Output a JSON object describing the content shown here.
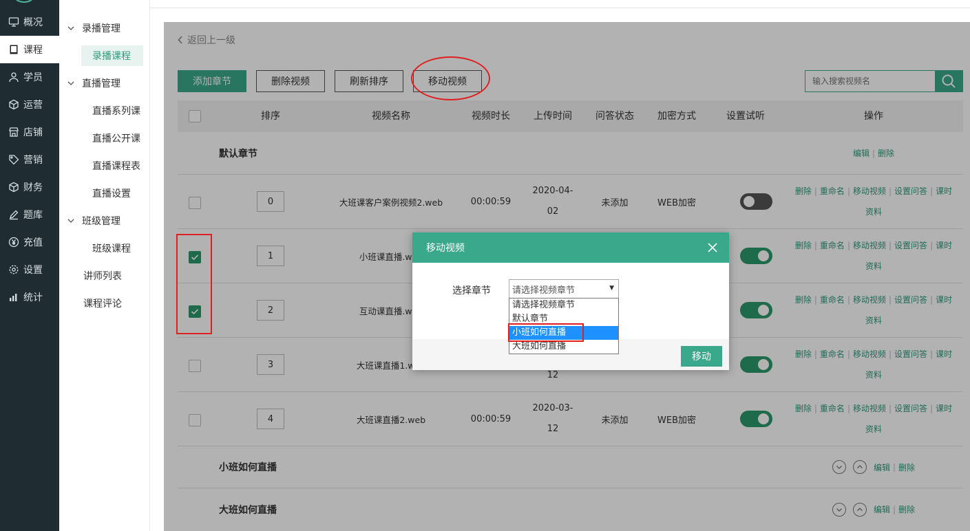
{
  "sidebar": {
    "items": [
      {
        "label": "概况",
        "icon": "monitor-icon"
      },
      {
        "label": "课程",
        "icon": "book-icon",
        "active": true
      },
      {
        "label": "学员",
        "icon": "user-icon"
      },
      {
        "label": "运营",
        "icon": "cube-icon"
      },
      {
        "label": "店铺",
        "icon": "shop-icon"
      },
      {
        "label": "营销",
        "icon": "tag-icon"
      },
      {
        "label": "财务",
        "icon": "cube-icon"
      },
      {
        "label": "题库",
        "icon": "pencil-icon"
      },
      {
        "label": "充值",
        "icon": "yen-icon"
      },
      {
        "label": "设置",
        "icon": "gear-icon"
      },
      {
        "label": "统计",
        "icon": "bar-chart-icon"
      }
    ]
  },
  "subnav": {
    "recorded_group": "录播管理",
    "recorded_course": "录播课程",
    "live_group": "直播管理",
    "live_series": "直播系列课",
    "live_open": "直播公开课",
    "live_schedule": "直播课程表",
    "live_settings": "直播设置",
    "class_group": "班级管理",
    "class_course": "班级课程",
    "teacher_list": "讲师列表",
    "course_review": "课程评论"
  },
  "main": {
    "back": "返回上一级",
    "buttons": {
      "add_chapter": "添加章节",
      "delete_video": "删除视频",
      "refresh_sort": "刷新排序",
      "move_video": "移动视频"
    },
    "search_placeholder": "输入搜索视频名"
  },
  "table": {
    "headers": [
      "排序",
      "视频名称",
      "视频时长",
      "上传时间",
      "问答状态",
      "加密方式",
      "设置试听",
      "操作"
    ],
    "default_chapter": "默认章节",
    "chapter_ops": {
      "edit": "编辑",
      "delete": "删除"
    },
    "row_ops": {
      "delete": "删除",
      "rename": "重命名",
      "move": "移动视频",
      "qa": "设置问答",
      "materials_1": "课时",
      "materials_2": "资料"
    },
    "rows": [
      {
        "order": "0",
        "name": "大班课客户案例视频2.web",
        "duration": "00:00:59",
        "date_1": "2020-04-",
        "date_2": "02",
        "qa": "未添加",
        "enc": "WEB加密",
        "trial": false,
        "checked": false
      },
      {
        "order": "1",
        "name": "小班课直播.web",
        "duration": "",
        "date_1": "",
        "date_2": "",
        "qa": "",
        "enc": "",
        "trial": true,
        "checked": true
      },
      {
        "order": "2",
        "name": "互动课直播.web",
        "duration": "",
        "date_1": "",
        "date_2": "",
        "qa": "",
        "enc": "",
        "trial": true,
        "checked": true
      },
      {
        "order": "3",
        "name": "大班课直播1.web",
        "duration": "",
        "date_1": "",
        "date_2": "12",
        "qa": "",
        "enc": "",
        "trial": true,
        "checked": false
      },
      {
        "order": "4",
        "name": "大班课直播2.web",
        "duration": "00:00:59",
        "date_1": "2020-03-",
        "date_2": "12",
        "qa": "未添加",
        "enc": "WEB加密",
        "trial": true,
        "checked": false
      }
    ],
    "chapters": [
      "小班如何直播",
      "大班如何直播"
    ]
  },
  "modal": {
    "title": "移动视频",
    "label": "选择章节",
    "select_value": "请选择视频章节",
    "options": [
      "请选择视频章节",
      "默认章节",
      "小班如何直播",
      "大班如何直播"
    ],
    "selected_option": "小班如何直播",
    "submit": "移动"
  },
  "colors": {
    "brand": "#3aa88a",
    "sidebar_bg": "#1f2d33",
    "highlight": "#e02020",
    "option_selected": "#1e90ff"
  }
}
